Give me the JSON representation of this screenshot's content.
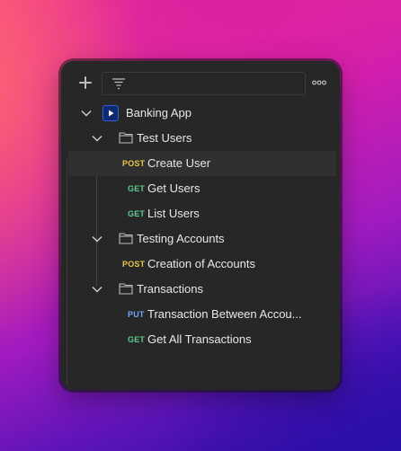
{
  "toolbar": {
    "add_icon": "plus-icon",
    "filter_icon": "filter-icon",
    "filter_placeholder": "",
    "more_icon": "more-horizontal-icon"
  },
  "collection": {
    "name": "Banking App",
    "icon": "collection-play-icon",
    "expanded": true,
    "folders": [
      {
        "name": "Test Users",
        "expanded": true,
        "requests": [
          {
            "method": "POST",
            "name": "Create User",
            "selected": true
          },
          {
            "method": "GET",
            "name": "Get Users"
          },
          {
            "method": "GET",
            "name": "List Users"
          }
        ]
      },
      {
        "name": "Testing Accounts",
        "expanded": true,
        "requests": [
          {
            "method": "POST",
            "name": "Creation of Accounts"
          }
        ]
      },
      {
        "name": "Transactions",
        "expanded": true,
        "requests": [
          {
            "method": "PUT",
            "name": "Transaction Between Accou..."
          },
          {
            "method": "GET",
            "name": "Get All Transactions"
          }
        ]
      }
    ]
  },
  "colors": {
    "post": "#e8c647",
    "get": "#5ccd8f",
    "put": "#6fa6f3",
    "panel_bg": "#272727",
    "collection_icon_bg": "#0f2a6e"
  }
}
